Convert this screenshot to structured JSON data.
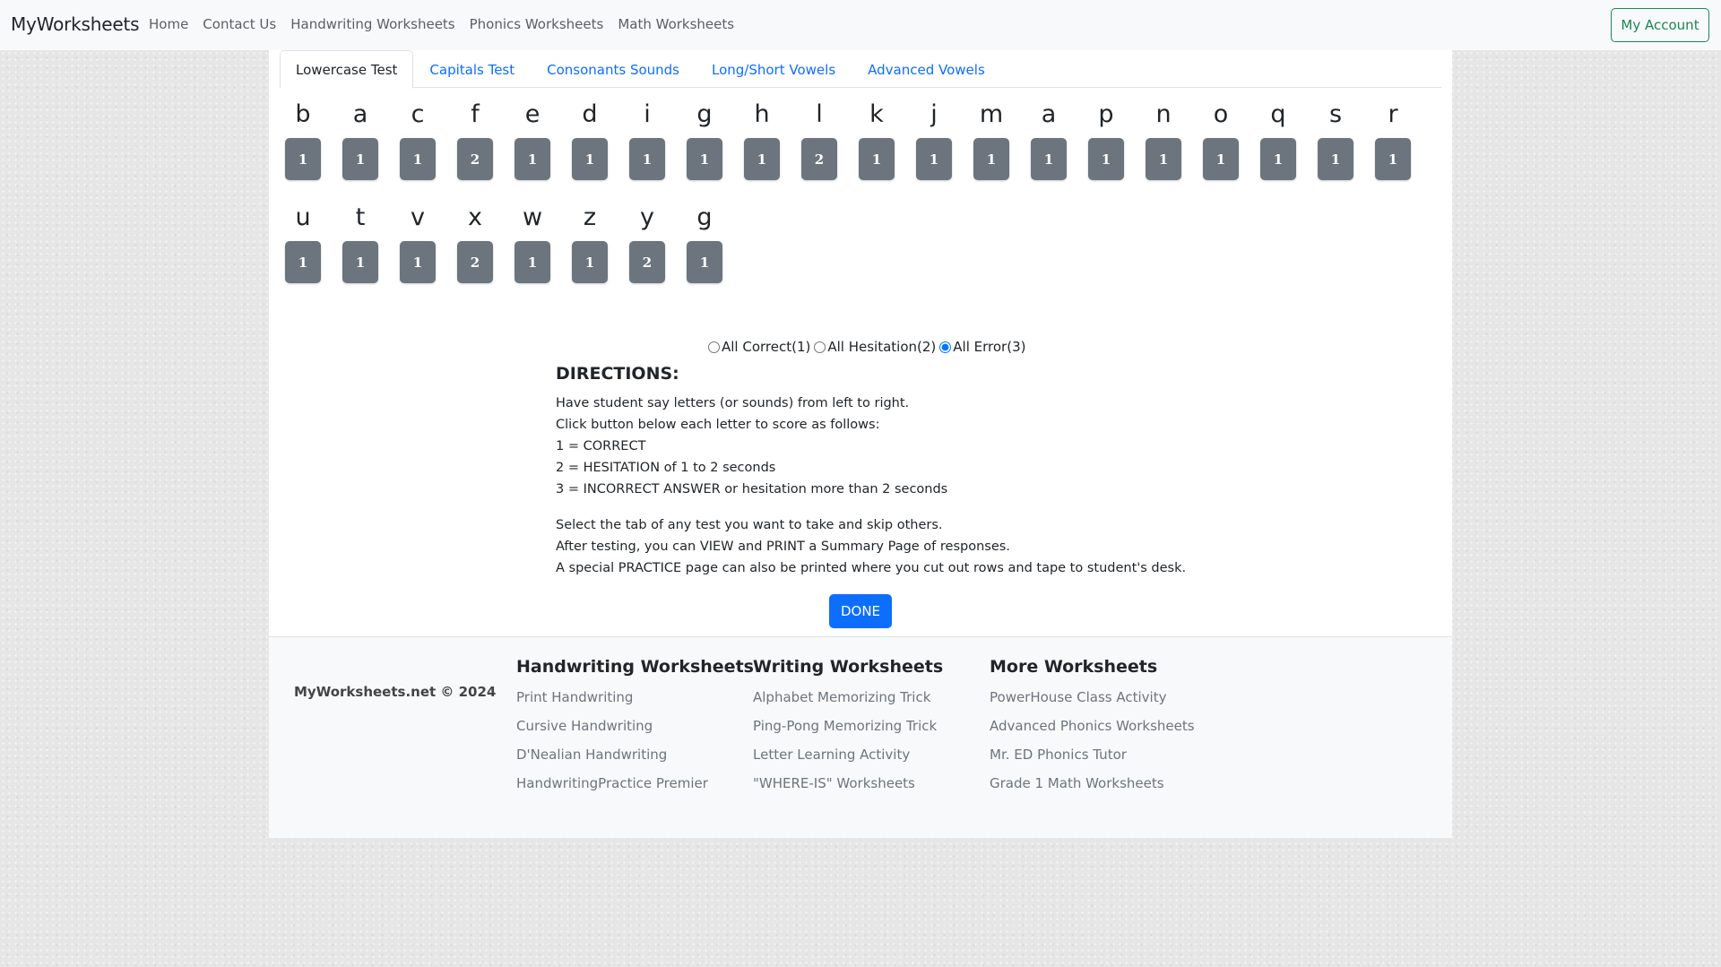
{
  "nav": {
    "brand": "MyWorksheets",
    "links": [
      "Home",
      "Contact Us",
      "Handwriting Worksheets",
      "Phonics Worksheets",
      "Math Worksheets"
    ],
    "account_button": "My Account"
  },
  "tabs": [
    {
      "label": "Lowercase Test",
      "active": true
    },
    {
      "label": "Capitals Test",
      "active": false
    },
    {
      "label": "Consonants Sounds",
      "active": false
    },
    {
      "label": "Long/Short Vowels",
      "active": false
    },
    {
      "label": "Advanced Vowels",
      "active": false
    }
  ],
  "letters": [
    {
      "letter": "b",
      "score": "1"
    },
    {
      "letter": "a",
      "score": "1"
    },
    {
      "letter": "c",
      "score": "1"
    },
    {
      "letter": "f",
      "score": "2"
    },
    {
      "letter": "e",
      "score": "1"
    },
    {
      "letter": "d",
      "score": "1"
    },
    {
      "letter": "i",
      "score": "1"
    },
    {
      "letter": "g",
      "score": "1"
    },
    {
      "letter": "h",
      "score": "1"
    },
    {
      "letter": "l",
      "score": "2"
    },
    {
      "letter": "k",
      "score": "1"
    },
    {
      "letter": "j",
      "score": "1"
    },
    {
      "letter": "m",
      "score": "1"
    },
    {
      "letter": "a",
      "score": "1"
    },
    {
      "letter": "p",
      "score": "1"
    },
    {
      "letter": "n",
      "score": "1"
    },
    {
      "letter": "o",
      "score": "1"
    },
    {
      "letter": "q",
      "score": "1"
    },
    {
      "letter": "s",
      "score": "1"
    },
    {
      "letter": "r",
      "score": "1"
    },
    {
      "letter": "u",
      "score": "1"
    },
    {
      "letter": "t",
      "score": "1"
    },
    {
      "letter": "v",
      "score": "1"
    },
    {
      "letter": "x",
      "score": "2"
    },
    {
      "letter": "w",
      "score": "1"
    },
    {
      "letter": "z",
      "score": "1"
    },
    {
      "letter": "y",
      "score": "2"
    },
    {
      "letter": "g",
      "score": "1"
    }
  ],
  "radio_options": [
    {
      "label": "All Correct(1)",
      "checked": false
    },
    {
      "label": "All Hesitation(2)",
      "checked": false
    },
    {
      "label": "All Error(3)",
      "checked": true
    }
  ],
  "directions": {
    "title": "DIRECTIONS:",
    "lines_1": [
      "Have student say letters (or sounds) from left to right.",
      "Click button below each letter to score as follows:",
      "1 = CORRECT",
      "2 = HESITATION of 1 to 2 seconds",
      "3 = INCORRECT ANSWER or hesitation more than 2 seconds"
    ],
    "lines_2": [
      "Select the tab of any test you want to take and skip others.",
      "After testing, you can VIEW and PRINT a Summary Page of responses.",
      "A special PRACTICE page can also be printed where you cut out rows and tape to student's desk."
    ]
  },
  "done_button": "DONE",
  "footer": {
    "copyright": "MyWorksheets.net © 2024",
    "columns": [
      {
        "title": "Handwriting Worksheets",
        "links": [
          "Print Handwriting",
          "Cursive Handwriting",
          "D'Nealian Handwriting",
          "HandwritingPractice Premier"
        ]
      },
      {
        "title": "Writing Worksheets",
        "links": [
          "Alphabet Memorizing Trick",
          "Ping-Pong Memorizing Trick",
          "Letter Learning Activity",
          "\"WHERE-IS\" Worksheets"
        ]
      },
      {
        "title": "More Worksheets",
        "links": [
          "PowerHouse Class Activity",
          "Advanced Phonics Worksheets",
          "Mr. ED Phonics Tutor",
          "Grade 1 Math Worksheets"
        ]
      }
    ]
  },
  "colors": {
    "score_button": "#6c757d",
    "primary": "#0d6efd",
    "account_outline": "#198754"
  }
}
